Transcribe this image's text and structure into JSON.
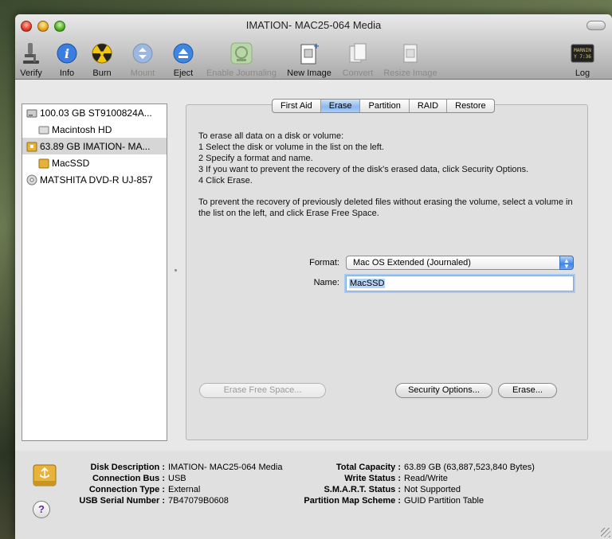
{
  "window": {
    "title": "IMATION- MAC25-064 Media"
  },
  "toolbar": {
    "verify": "Verify",
    "info": "Info",
    "burn": "Burn",
    "mount": "Mount",
    "eject": "Eject",
    "enable_journaling": "Enable Journaling",
    "new_image": "New Image",
    "convert": "Convert",
    "resize_image": "Resize Image",
    "log": "Log",
    "log_icon_text": "MARNIN\nY 7:36"
  },
  "sidebar": {
    "items": [
      {
        "label": "100.03 GB ST9100824A...",
        "kind": "disk"
      },
      {
        "label": "Macintosh HD",
        "kind": "volume"
      },
      {
        "label": "63.89 GB IMATION- MA...",
        "kind": "usb-disk"
      },
      {
        "label": "MacSSD",
        "kind": "usb-volume"
      },
      {
        "label": "MATSHITA DVD-R UJ-857",
        "kind": "optical"
      }
    ]
  },
  "tabs": [
    "First Aid",
    "Erase",
    "Partition",
    "RAID",
    "Restore"
  ],
  "erase": {
    "instructions": [
      "To erase all data on a disk or volume:",
      "1 Select the disk or volume in the list on the left.",
      "2 Specify a format and name.",
      "3 If you want to prevent the recovery of the disk's erased data, click Security Options.",
      "4 Click Erase."
    ],
    "free_space_note": "To prevent the recovery of previously deleted files without erasing the volume, select a volume in the list on the left, and click Erase Free Space.",
    "format_label": "Format:",
    "format_value": "Mac OS Extended (Journaled)",
    "name_label": "Name:",
    "name_value": "MacSSD",
    "erase_free_space": "Erase Free Space...",
    "security_options": "Security Options...",
    "erase_button": "Erase..."
  },
  "info": {
    "left": [
      {
        "k": "Disk Description :",
        "v": "IMATION- MAC25-064 Media"
      },
      {
        "k": "Connection Bus :",
        "v": "USB"
      },
      {
        "k": "Connection Type :",
        "v": "External"
      },
      {
        "k": "USB Serial Number :",
        "v": "7B47079B0608"
      }
    ],
    "right": [
      {
        "k": "Total Capacity :",
        "v": "63.89 GB (63,887,523,840 Bytes)"
      },
      {
        "k": "Write Status :",
        "v": "Read/Write"
      },
      {
        "k": "S.M.A.R.T. Status :",
        "v": "Not Supported"
      },
      {
        "k": "Partition Map Scheme :",
        "v": "GUID Partition Table"
      }
    ]
  },
  "help": "?"
}
